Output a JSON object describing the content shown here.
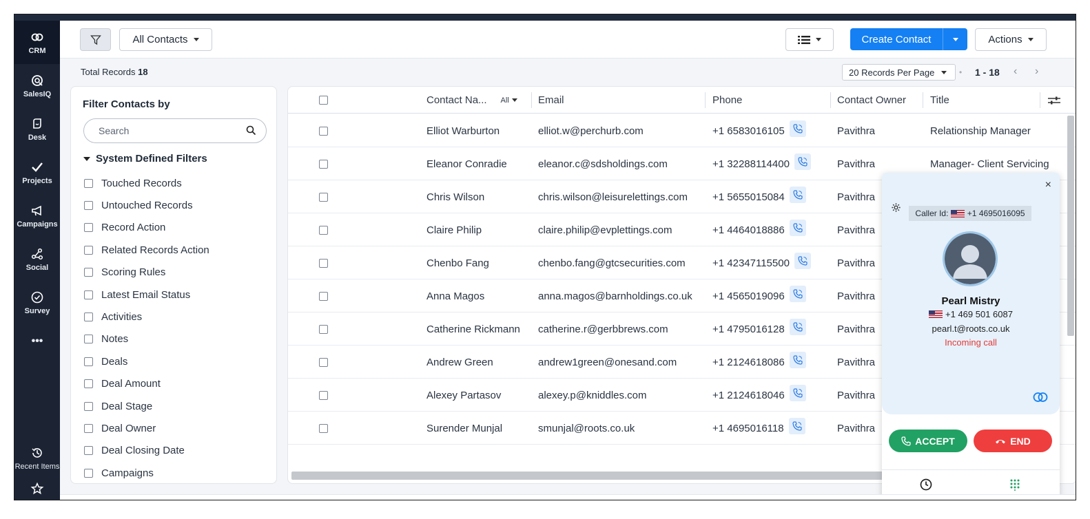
{
  "rail": {
    "items": [
      {
        "label": "CRM",
        "icon": "crm-icon"
      },
      {
        "label": "SalesIQ",
        "icon": "salesiq-icon"
      },
      {
        "label": "Desk",
        "icon": "desk-icon"
      },
      {
        "label": "Projects",
        "icon": "projects-icon"
      },
      {
        "label": "Campaigns",
        "icon": "megaphone-icon"
      },
      {
        "label": "Social",
        "icon": "social-icon"
      },
      {
        "label": "Survey",
        "icon": "check-circle-icon"
      }
    ],
    "more": "•••",
    "recent": "Recent Items",
    "favorites_icon": "star-icon"
  },
  "header": {
    "view_label": "All Contacts",
    "create_label": "Create Contact",
    "actions_label": "Actions"
  },
  "subheader": {
    "total_label": "Total Records",
    "total_count": "18",
    "per_page": "20 Records Per Page",
    "range": "1 - 18"
  },
  "filter": {
    "title": "Filter Contacts by",
    "search_placeholder": "Search",
    "section": "System Defined Filters",
    "items": [
      "Touched Records",
      "Untouched Records",
      "Record Action",
      "Related Records Action",
      "Scoring Rules",
      "Latest Email Status",
      "Activities",
      "Notes",
      "Deals",
      "Deal Amount",
      "Deal Stage",
      "Deal Owner",
      "Deal Closing Date",
      "Campaigns"
    ]
  },
  "table": {
    "columns": {
      "name": "Contact Na...",
      "all": "All",
      "email": "Email",
      "phone": "Phone",
      "owner": "Contact Owner",
      "title": "Title"
    },
    "rows": [
      {
        "name": "Elliot Warburton",
        "email": "elliot.w@perchurb.com",
        "phone": "+1 6583016105",
        "owner": "Pavithra",
        "title": "Relationship Manager"
      },
      {
        "name": "Eleanor Conradie",
        "email": "eleanor.c@sdsholdings.com",
        "phone": "+1 32288114400",
        "owner": "Pavithra",
        "title": "Manager- Client Servicing"
      },
      {
        "name": "Chris Wilson",
        "email": "chris.wilson@leisurelettings.com",
        "phone": "+1 5655015084",
        "owner": "Pavithra",
        "title": ""
      },
      {
        "name": "Claire Philip",
        "email": "claire.philip@evplettings.com",
        "phone": "+1 4464018886",
        "owner": "Pavithra",
        "title": ""
      },
      {
        "name": "Chenbo Fang",
        "email": "chenbo.fang@gtcsecurities.com",
        "phone": "+1 42347115500",
        "owner": "Pavithra",
        "title": ""
      },
      {
        "name": "Anna Magos",
        "email": "anna.magos@barnholdings.co.uk",
        "phone": "+1 4565019096",
        "owner": "Pavithra",
        "title": ""
      },
      {
        "name": "Catherine Rickmann",
        "email": "catherine.r@gerbbrews.com",
        "phone": "+1 4795016128",
        "owner": "Pavithra",
        "title": ""
      },
      {
        "name": "Andrew Green",
        "email": "andrew1green@onesand.com",
        "phone": "+1 2124618086",
        "owner": "Pavithra",
        "title": ""
      },
      {
        "name": "Alexey Partasov",
        "email": "alexey.p@kniddles.com",
        "phone": "+1 2124618046",
        "owner": "Pavithra",
        "title": ""
      },
      {
        "name": "Surender Munjal",
        "email": "smunjal@roots.co.uk",
        "phone": "+1 4695016118",
        "owner": "Pavithra",
        "title": ""
      }
    ]
  },
  "call": {
    "caller_id_label": "Caller Id:",
    "caller_id_number": "+1 4695016095",
    "name": "Pearl Mistry",
    "phone": "+1 469 501 6087",
    "email": "pearl.t@roots.co.uk",
    "status": "Incoming call",
    "accept": "ACCEPT",
    "end": "END",
    "close": "×"
  },
  "colors": {
    "primary": "#1480f3",
    "accept": "#21a163",
    "end": "#ef3e3e",
    "rail": "#1c2434",
    "incoming": "#e53935"
  }
}
